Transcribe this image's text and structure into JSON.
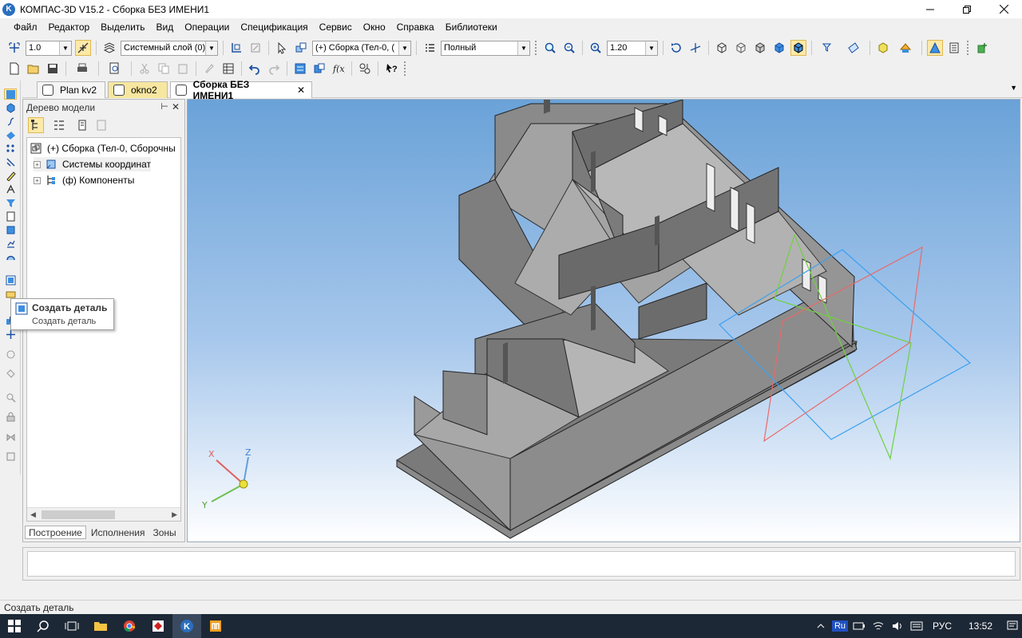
{
  "window": {
    "title": "КОМПАС-3D V15.2  - Сборка БЕЗ ИМЕНИ1",
    "logo_letter": "K",
    "controls": [
      "minimize-icon",
      "restore-icon",
      "close-icon"
    ]
  },
  "menu": {
    "items": [
      "Файл",
      "Редактор",
      "Выделить",
      "Вид",
      "Операции",
      "Спецификация",
      "Сервис",
      "Окно",
      "Справка",
      "Библиотеки"
    ]
  },
  "toolbar": {
    "step_value": "1.0",
    "layer_value": "Системный слой (0)",
    "assembly_value": "(+) Сборка (Тел-0, (",
    "view_mode_value": "Полный",
    "zoom_value": "1.20"
  },
  "tabs": [
    {
      "label": "Plan kv2"
    },
    {
      "label": "okno2"
    },
    {
      "label": "Сборка БЕЗ ИМЕНИ1",
      "close": "✕"
    }
  ],
  "tree_panel": {
    "title": "Дерево модели",
    "pin": "ᵖ",
    "close": "✕",
    "items": [
      {
        "label": "(+) Сборка (Тел-0, Сборочны"
      },
      {
        "label": "Системы координат"
      },
      {
        "label": "(ф) Компоненты"
      }
    ],
    "tabs": [
      "Построение",
      "Исполнения",
      "Зоны"
    ]
  },
  "tooltip": {
    "title": "Создать деталь",
    "text": "Создать деталь"
  },
  "axes": {
    "x": "X",
    "y": "Y",
    "z": "Z"
  },
  "status": {
    "text": "Создать деталь"
  },
  "taskbar": {
    "lang_badge": "Ru",
    "lang": "РУС",
    "time": "13:52"
  },
  "colors": {
    "viewport_top": "#6aa2d8",
    "viewport_bottom": "#ffffff",
    "model_gray": "#8c8c8c",
    "plane_blue": "#3aa0f0",
    "plane_green": "#70d040",
    "plane_red": "#e86a6a",
    "taskbar": "#1d2836"
  }
}
